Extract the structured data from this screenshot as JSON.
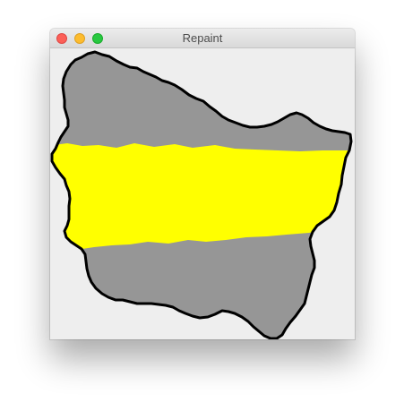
{
  "window": {
    "title": "Repaint",
    "controls": [
      "close",
      "minimize",
      "zoom"
    ]
  },
  "canvas": {
    "region_fill": "#969696",
    "region_outline": "#000000",
    "highlight_fill": "#ffff00",
    "background": "#eeeeee"
  }
}
